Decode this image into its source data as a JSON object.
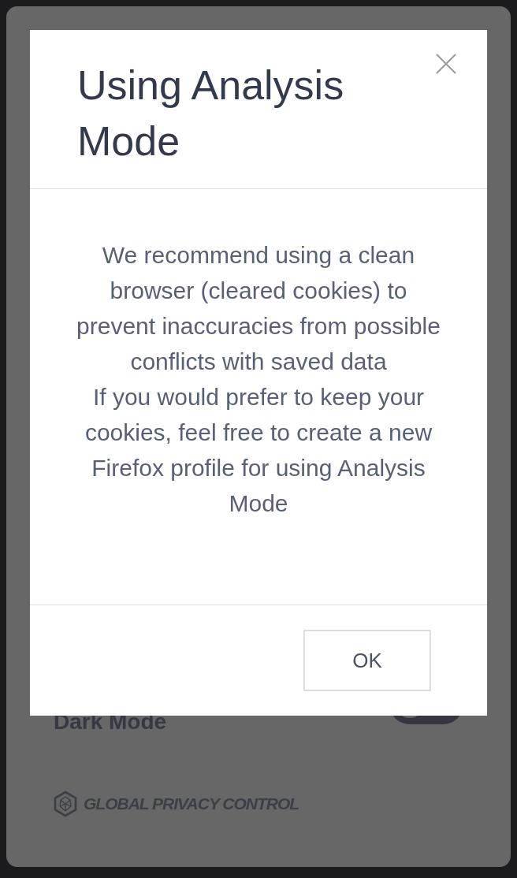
{
  "modal": {
    "title": "Using Analysis Mode",
    "paragraphs": [
      "We recommend using a clean browser (cleared cookies) to prevent inaccuracies from possible conflicts with saved data",
      "If you would prefer to keep your cookies, feel free to create a new Firefox profile for using Analysis Mode"
    ],
    "button": "OK"
  },
  "settings": [
    {
      "label": "Dark Mode",
      "on": false
    }
  ],
  "footer": {
    "logo_text": "GLOBAL PRIVACY CONTROL"
  }
}
